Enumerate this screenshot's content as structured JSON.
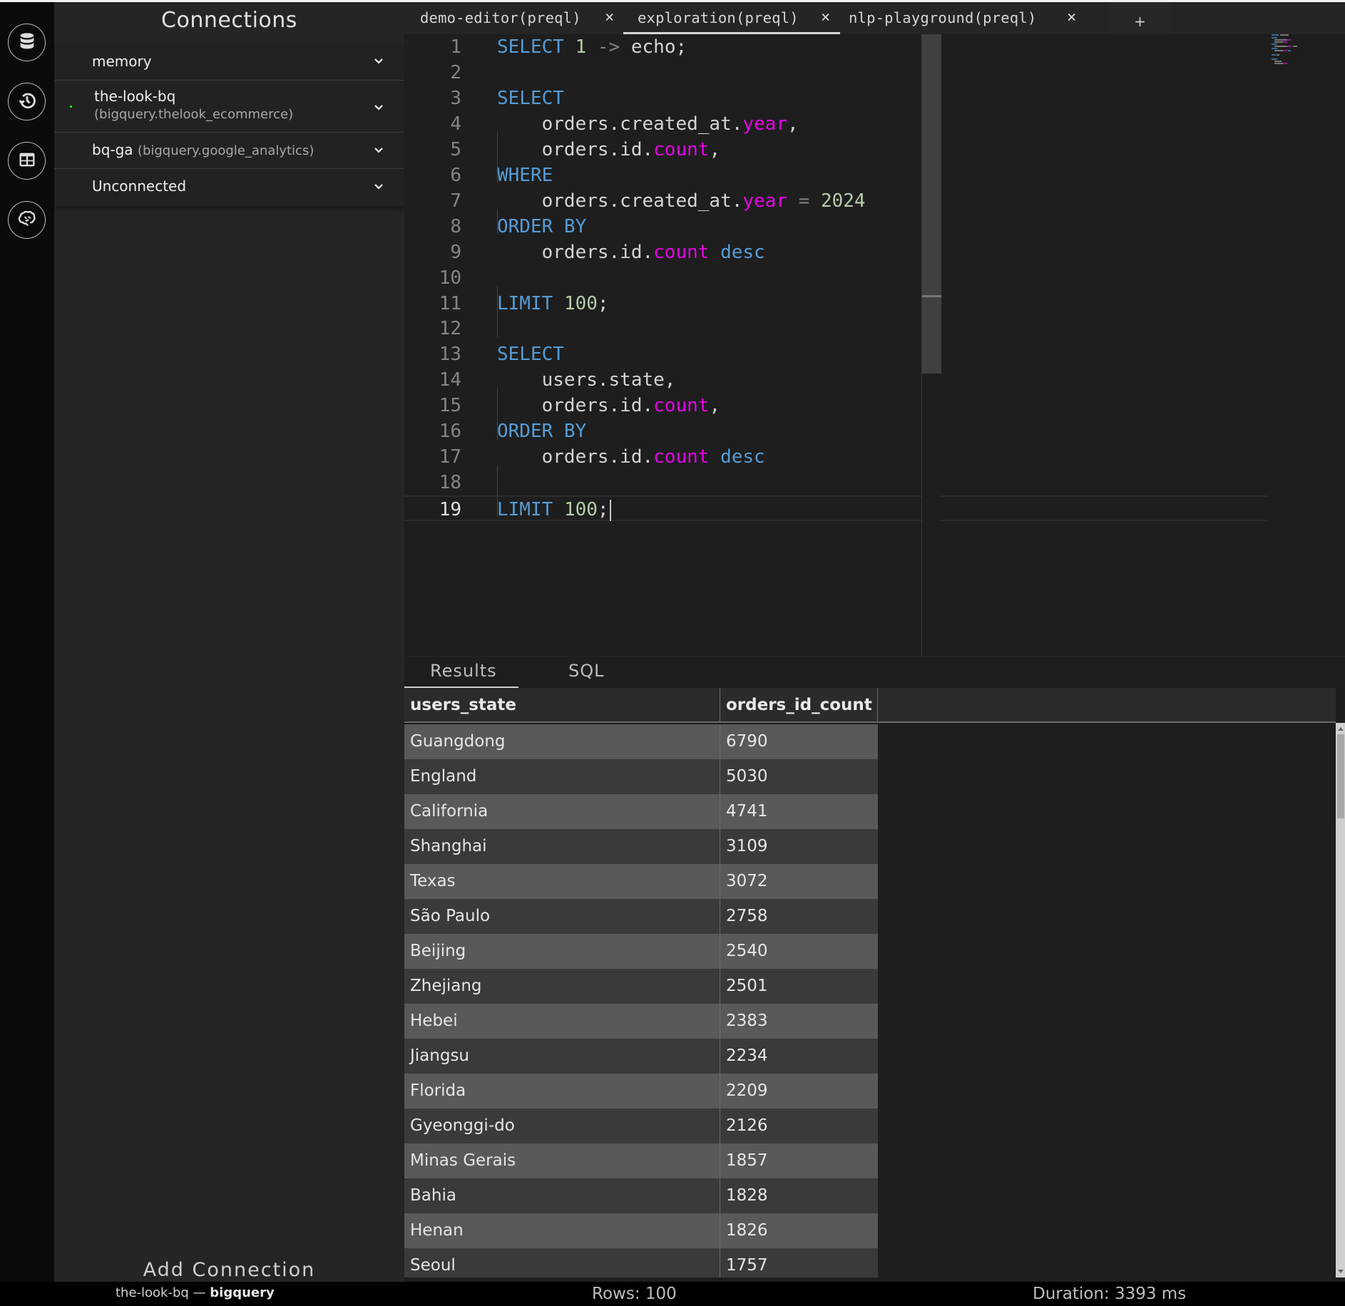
{
  "rail": {
    "items": [
      {
        "icon": "database-icon",
        "label": "Connections"
      },
      {
        "icon": "history-icon",
        "label": "History"
      },
      {
        "icon": "table-icon",
        "label": "Tables"
      },
      {
        "icon": "brain-icon",
        "label": "LLM"
      }
    ]
  },
  "sidebar": {
    "title": "Connections",
    "connections": [
      {
        "name": "memory",
        "detail": "",
        "connected": false
      },
      {
        "name": "the-look-bq",
        "detail": "(bigquery.thelook_ecommerce)",
        "connected": true
      },
      {
        "name": "bq-ga",
        "detail": "(bigquery.google_analytics)",
        "connected": false
      },
      {
        "name": "Unconnected",
        "detail": "",
        "connected": false
      }
    ],
    "add_connection": "Add Connection"
  },
  "tabs": [
    {
      "label": "demo-editor(preql)",
      "close": "×",
      "active": false
    },
    {
      "label": "exploration(preql)",
      "close": "×",
      "active": true
    },
    {
      "label": "nlp-playground(preql)",
      "close": "×",
      "active": false
    }
  ],
  "tab_add": "+",
  "editor": {
    "lines": [
      {
        "n": "1",
        "tokens": [
          [
            "kw",
            "SELECT"
          ],
          [
            "t",
            " "
          ],
          [
            "num",
            "1"
          ],
          [
            "t",
            " "
          ],
          [
            "op",
            "->"
          ],
          [
            "t",
            " echo;"
          ]
        ]
      },
      {
        "n": "2",
        "tokens": []
      },
      {
        "n": "3",
        "tokens": [
          [
            "kw",
            "SELECT"
          ]
        ]
      },
      {
        "n": "4",
        "tokens": [
          [
            "t",
            "    orders.created_at."
          ],
          [
            "fn",
            "year"
          ],
          [
            "t",
            ","
          ]
        ]
      },
      {
        "n": "5",
        "tokens": [
          [
            "t",
            "    orders.id."
          ],
          [
            "fn",
            "count"
          ],
          [
            "t",
            ","
          ]
        ]
      },
      {
        "n": "6",
        "tokens": [
          [
            "kw",
            "WHERE"
          ]
        ]
      },
      {
        "n": "7",
        "tokens": [
          [
            "t",
            "    orders.created_at."
          ],
          [
            "fn",
            "year"
          ],
          [
            "t",
            " "
          ],
          [
            "op",
            "="
          ],
          [
            "t",
            " "
          ],
          [
            "num",
            "2024"
          ]
        ]
      },
      {
        "n": "8",
        "tokens": [
          [
            "kw",
            "ORDER BY"
          ]
        ]
      },
      {
        "n": "9",
        "tokens": [
          [
            "t",
            "    orders.id."
          ],
          [
            "fn",
            "count"
          ],
          [
            "t",
            " "
          ],
          [
            "kw",
            "desc"
          ]
        ]
      },
      {
        "n": "10",
        "tokens": []
      },
      {
        "n": "11",
        "tokens": [
          [
            "kw",
            "LIMIT"
          ],
          [
            "t",
            " "
          ],
          [
            "num",
            "100"
          ],
          [
            "t",
            ";"
          ]
        ]
      },
      {
        "n": "12",
        "tokens": []
      },
      {
        "n": "13",
        "tokens": [
          [
            "kw",
            "SELECT"
          ]
        ]
      },
      {
        "n": "14",
        "tokens": [
          [
            "t",
            "    users.state,"
          ]
        ]
      },
      {
        "n": "15",
        "tokens": [
          [
            "t",
            "    orders.id."
          ],
          [
            "fn",
            "count"
          ],
          [
            "t",
            ","
          ]
        ]
      },
      {
        "n": "16",
        "tokens": [
          [
            "kw",
            "ORDER BY"
          ]
        ]
      },
      {
        "n": "17",
        "tokens": [
          [
            "t",
            "    orders.id."
          ],
          [
            "fn",
            "count"
          ],
          [
            "t",
            " "
          ],
          [
            "kw",
            "desc"
          ]
        ]
      },
      {
        "n": "18",
        "tokens": []
      },
      {
        "n": "19",
        "tokens": [
          [
            "kw",
            "LIMIT"
          ],
          [
            "t",
            " "
          ],
          [
            "num",
            "100"
          ],
          [
            "t",
            ";"
          ]
        ]
      }
    ],
    "current_line": 19
  },
  "results": {
    "tabs": [
      {
        "label": "Results",
        "active": true
      },
      {
        "label": "SQL",
        "active": false
      }
    ],
    "columns": [
      "users_state",
      "orders_id_count"
    ],
    "rows": [
      [
        "Guangdong",
        "6790"
      ],
      [
        "England",
        "5030"
      ],
      [
        "California",
        "4741"
      ],
      [
        "Shanghai",
        "3109"
      ],
      [
        "Texas",
        "3072"
      ],
      [
        "São Paulo",
        "2758"
      ],
      [
        "Beijing",
        "2540"
      ],
      [
        "Zhejiang",
        "2501"
      ],
      [
        "Hebei",
        "2383"
      ],
      [
        "Jiangsu",
        "2234"
      ],
      [
        "Florida",
        "2209"
      ],
      [
        "Gyeonggi-do",
        "2126"
      ],
      [
        "Minas Gerais",
        "1857"
      ],
      [
        "Bahia",
        "1828"
      ],
      [
        "Henan",
        "1826"
      ],
      [
        "Seoul",
        "1757"
      ]
    ]
  },
  "status": {
    "connection_name": "the-look-bq",
    "separator": " — ",
    "connection_type": "bigquery",
    "rows": "Rows: 100",
    "duration": "Duration: 3393 ms"
  },
  "colors": {
    "keyword": "#569cd6",
    "number": "#b5cea8",
    "function": "#e600e6",
    "connected_dot": "#22dd22"
  }
}
